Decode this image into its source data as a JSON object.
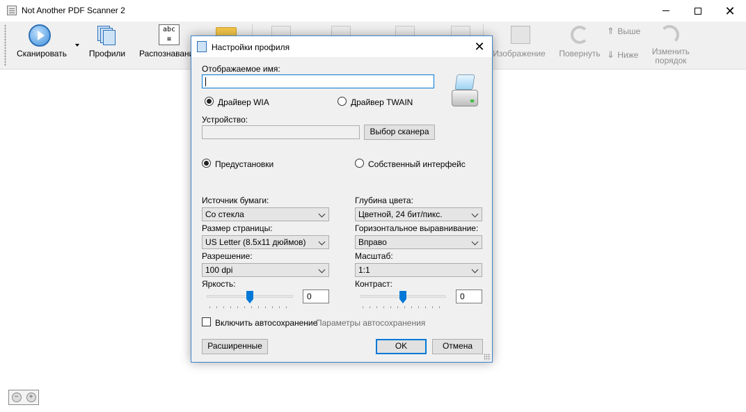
{
  "app": {
    "title": "Not Another PDF Scanner 2"
  },
  "toolbar": {
    "scan_label": "Сканировать",
    "profiles_label": "Профили",
    "ocr_label": "Распознавани",
    "image_label": "Изображение",
    "rotate_label": "Повернуть",
    "move_up_label": "Выше",
    "move_down_label": "Ниже",
    "reorder_label_1": "Изменить",
    "reorder_label_2": "порядок"
  },
  "dialog": {
    "title": "Настройки профиля",
    "display_name_label": "Отображаемое имя:",
    "display_name_value": "",
    "driver_wia_label": "Драйвер WIA",
    "driver_twain_label": "Драйвер TWAIN",
    "driver_selected": "WIA",
    "device_label": "Устройство:",
    "device_value": "",
    "choose_scanner_label": "Выбор сканера",
    "presets_label": "Предустановки",
    "native_ui_label": "Собственный интерфейс",
    "ui_mode_selected": "presets",
    "paper_source_label": "Источник бумаги:",
    "paper_source_value": "Со стекла",
    "page_size_label": "Размер страницы:",
    "page_size_value": "US Letter (8.5x11 дюймов)",
    "resolution_label": "Разрешение:",
    "resolution_value": "100 dpi",
    "brightness_label": "Яркость:",
    "brightness_value": "0",
    "color_depth_label": "Глубина цвета:",
    "color_depth_value": "Цветной, 24 бит/пикс.",
    "horizontal_align_label": "Горизонтальное выравнивание:",
    "horizontal_align_value": "Вправо",
    "scale_label": "Масштаб:",
    "scale_value": "1:1",
    "contrast_label": "Контраст:",
    "contrast_value": "0",
    "enable_autosave_label": "Включить автосохранение",
    "enable_autosave_checked": false,
    "autosave_settings_label": "Параметры автосохранения",
    "advanced_label": "Расширенные",
    "ok_label": "OK",
    "cancel_label": "Отмена"
  }
}
